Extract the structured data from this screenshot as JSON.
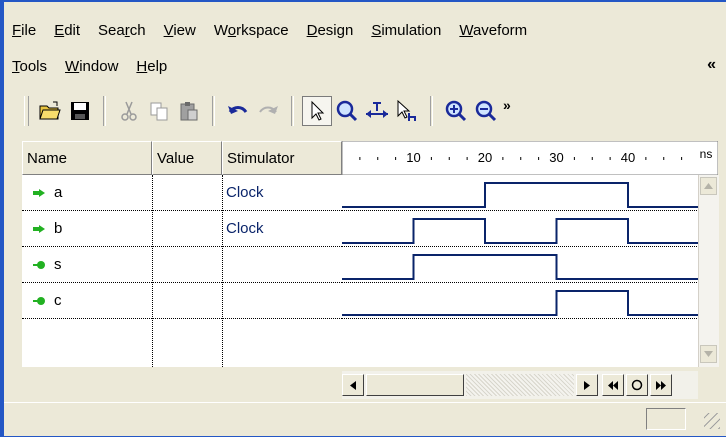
{
  "menu": {
    "row1": [
      {
        "acc": "F",
        "rest": "ile"
      },
      {
        "acc": "E",
        "rest": "dit"
      },
      {
        "pre": "Sea",
        "acc": "r",
        "rest": "ch"
      },
      {
        "acc": "V",
        "rest": "iew"
      },
      {
        "pre": "W",
        "acc": "o",
        "rest": "rkspace"
      },
      {
        "acc": "D",
        "rest": "esign"
      },
      {
        "acc": "S",
        "rest": "imulation"
      },
      {
        "acc": "W",
        "rest": "aveform"
      }
    ],
    "row2": [
      {
        "acc": "T",
        "rest": "ools"
      },
      {
        "acc": "W",
        "rest": "indow"
      },
      {
        "acc": "H",
        "rest": "elp"
      }
    ],
    "chevron": "«"
  },
  "toolbar": {
    "overflow": "»",
    "icons": [
      "open-folder-icon",
      "save-icon",
      "cut-icon",
      "copy-icon",
      "paste-icon",
      "undo-icon",
      "redo-icon",
      "select-pointer-icon",
      "zoom-icon",
      "measure-icon",
      "select-range-icon",
      "zoom-in-icon",
      "zoom-out-icon"
    ]
  },
  "columns": {
    "name": "Name",
    "value": "Value",
    "stimulator": "Stimulator"
  },
  "ruler": {
    "ticks": [
      "10",
      "20",
      "30",
      "40"
    ],
    "unit": "ns"
  },
  "signals": [
    {
      "name": "a",
      "value": "",
      "stimulator": "Clock",
      "type": "input"
    },
    {
      "name": "b",
      "value": "",
      "stimulator": "Clock",
      "type": "input"
    },
    {
      "name": "s",
      "value": "",
      "stimulator": "",
      "type": "output"
    },
    {
      "name": "c",
      "value": "",
      "stimulator": "",
      "type": "output"
    }
  ],
  "waveforms": {
    "time_unit": "ns",
    "a": [
      [
        0,
        0
      ],
      [
        20,
        1
      ],
      [
        40,
        0
      ],
      [
        50,
        0
      ]
    ],
    "b": [
      [
        0,
        0
      ],
      [
        10,
        1
      ],
      [
        20,
        0
      ],
      [
        30,
        1
      ],
      [
        40,
        0
      ],
      [
        50,
        0
      ]
    ],
    "s": [
      [
        0,
        0
      ],
      [
        10,
        1
      ],
      [
        30,
        0
      ],
      [
        50,
        0
      ]
    ],
    "c": [
      [
        0,
        0
      ],
      [
        30,
        1
      ],
      [
        40,
        0
      ],
      [
        50,
        0
      ]
    ]
  },
  "colors": {
    "wave": "#0a246a",
    "input_icon": "#22b122",
    "output_icon": "#22b122",
    "title_border": "#2457c5"
  }
}
